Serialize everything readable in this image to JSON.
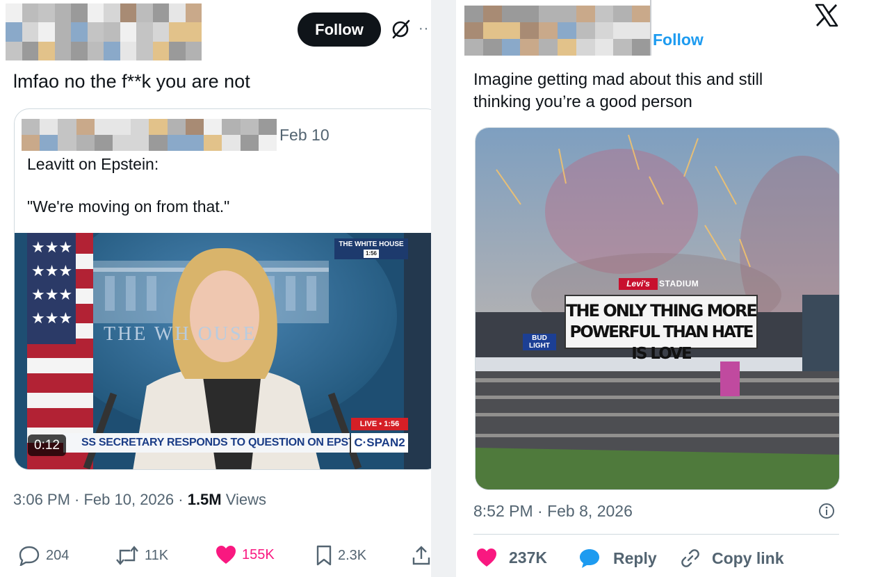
{
  "left_tweet": {
    "follow_label": "Follow",
    "more_label": "··",
    "text": "lmfao no the f**k you are not",
    "quote": {
      "date": "Feb 10",
      "line1": "Leavitt on Epstein:",
      "line2": "\"We're moving on from that.\"",
      "video": {
        "duration": "0:12",
        "chyron": "SS SECRETARY RESPONDS TO QUESTION ON EPSTEIN FILES",
        "network": "C·SPAN2",
        "live": "LIVE • 1:56",
        "corner_tag": "THE WHITE HOUSE",
        "corner_time": "1:56",
        "backdrop_text": "THE WH   OUSE"
      }
    },
    "timestamp": "3:06 PM · Feb 10, 2026 · ",
    "views_count": "1.5M",
    "views_label": " Views",
    "actions": {
      "replies": "204",
      "reposts": "11K",
      "likes": "155K",
      "bookmarks": "2.3K"
    },
    "colors": {
      "like": "#f91880",
      "follow_bg": "#0f1419"
    }
  },
  "right_tweet": {
    "follow_label": "Follow",
    "logo": "x-logo",
    "text_line1": "Imagine getting mad about this and still",
    "text_line2": "thinking you’re a good person",
    "photo": {
      "brand": "Levi's",
      "venue": "STADIUM",
      "billboard_line1": "THE ONLY THING MORE",
      "billboard_line2": "POWERFUL THAN HATE IS LOVE",
      "sponsor": "BUD LIGHT"
    },
    "timestamp": "8:52 PM · Feb 8, 2026",
    "actions": {
      "likes": "237K",
      "reply_label": "Reply",
      "copy_label": "Copy link"
    },
    "colors": {
      "like": "#f91880",
      "reply": "#1d9bf0",
      "follow": "#1d9bf0"
    }
  }
}
